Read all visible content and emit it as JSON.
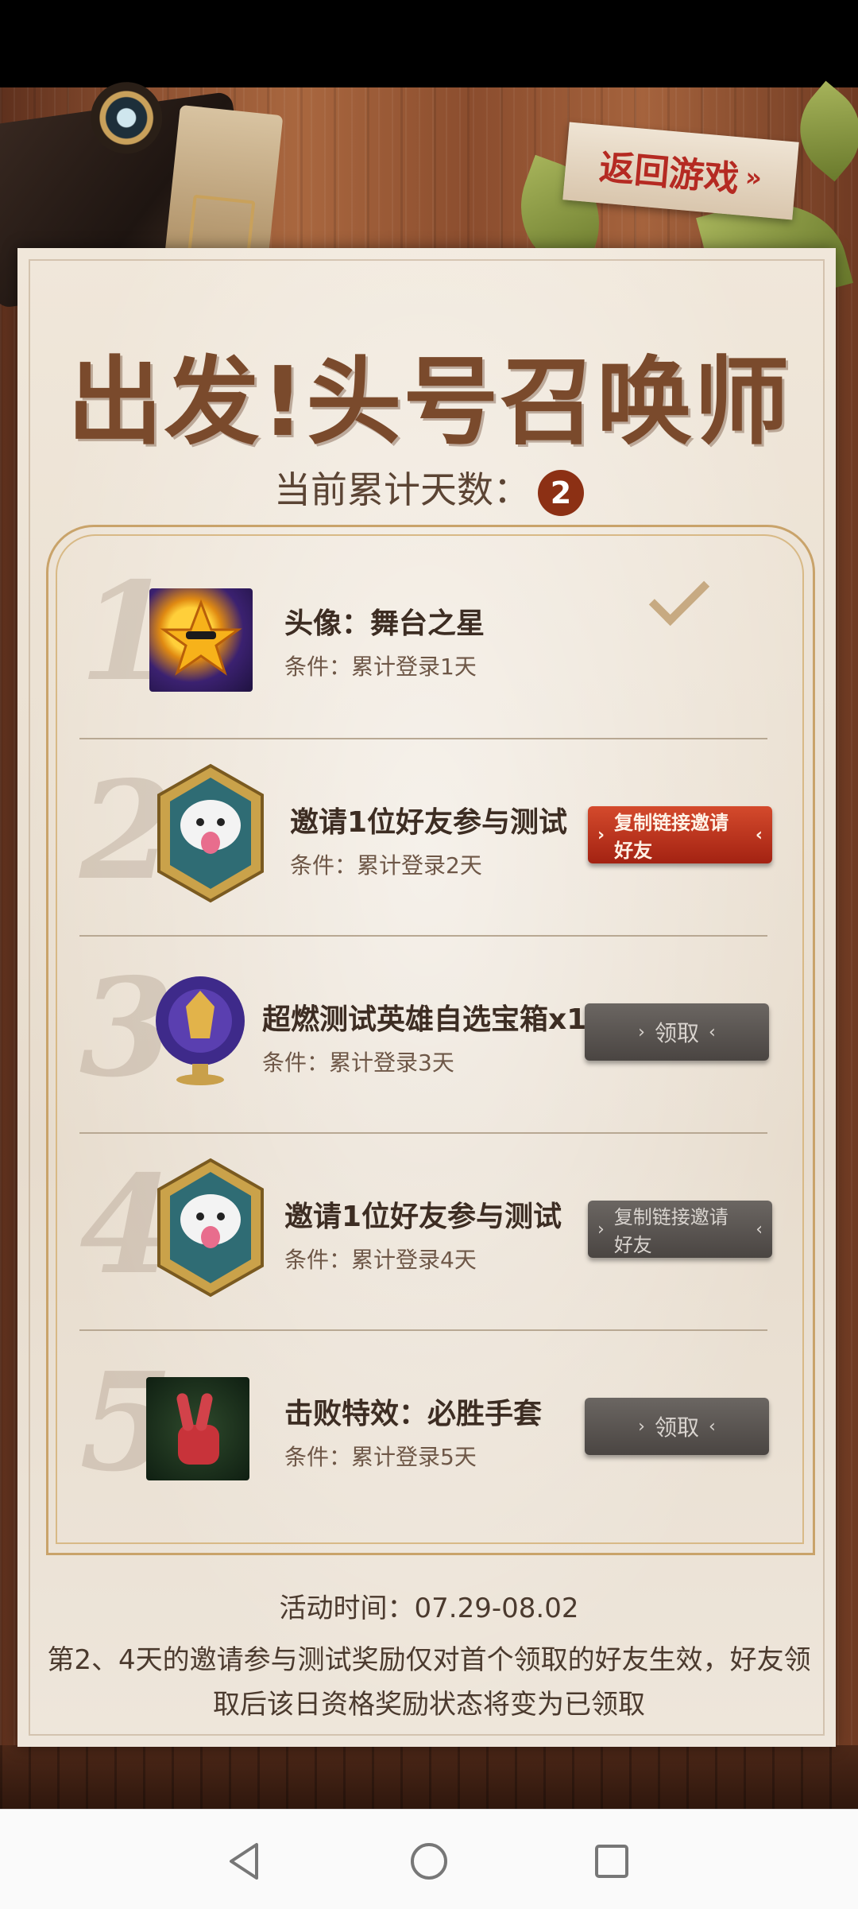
{
  "header": {
    "return_label": "返回游戏",
    "return_arrow": "»"
  },
  "title": "出发!头号召唤师",
  "progress": {
    "label": "当前累计天数：",
    "days": "2"
  },
  "rewards": [
    {
      "num": "1",
      "title": "头像：舞台之星",
      "condition": "条件：累计登录1天",
      "status": "claimed"
    },
    {
      "num": "2",
      "title": "邀请1位好友参与测试",
      "condition": "条件：累计登录2天",
      "button": "复制链接邀请好友",
      "button_style": "active"
    },
    {
      "num": "3",
      "title": "超燃测试英雄自选宝箱x1",
      "condition": "条件：累计登录3天",
      "button": "领取",
      "button_style": "disabled"
    },
    {
      "num": "4",
      "title": "邀请1位好友参与测试",
      "condition": "条件：累计登录4天",
      "button": "复制链接邀请好友",
      "button_style": "disabled"
    },
    {
      "num": "5",
      "title": "击败特效：必胜手套",
      "condition": "条件：累计登录5天",
      "button": "领取",
      "button_style": "disabled"
    }
  ],
  "footer": {
    "time": "活动时间：07.29-08.02",
    "note": "第2、4天的邀请参与测试奖励仅对首个领取的好友生效，好友领取后该日资格奖励状态将变为已领取"
  },
  "colors": {
    "accent_red": "#b52a22",
    "badge": "#8c3014",
    "title_brown": "#7a4a2c"
  }
}
